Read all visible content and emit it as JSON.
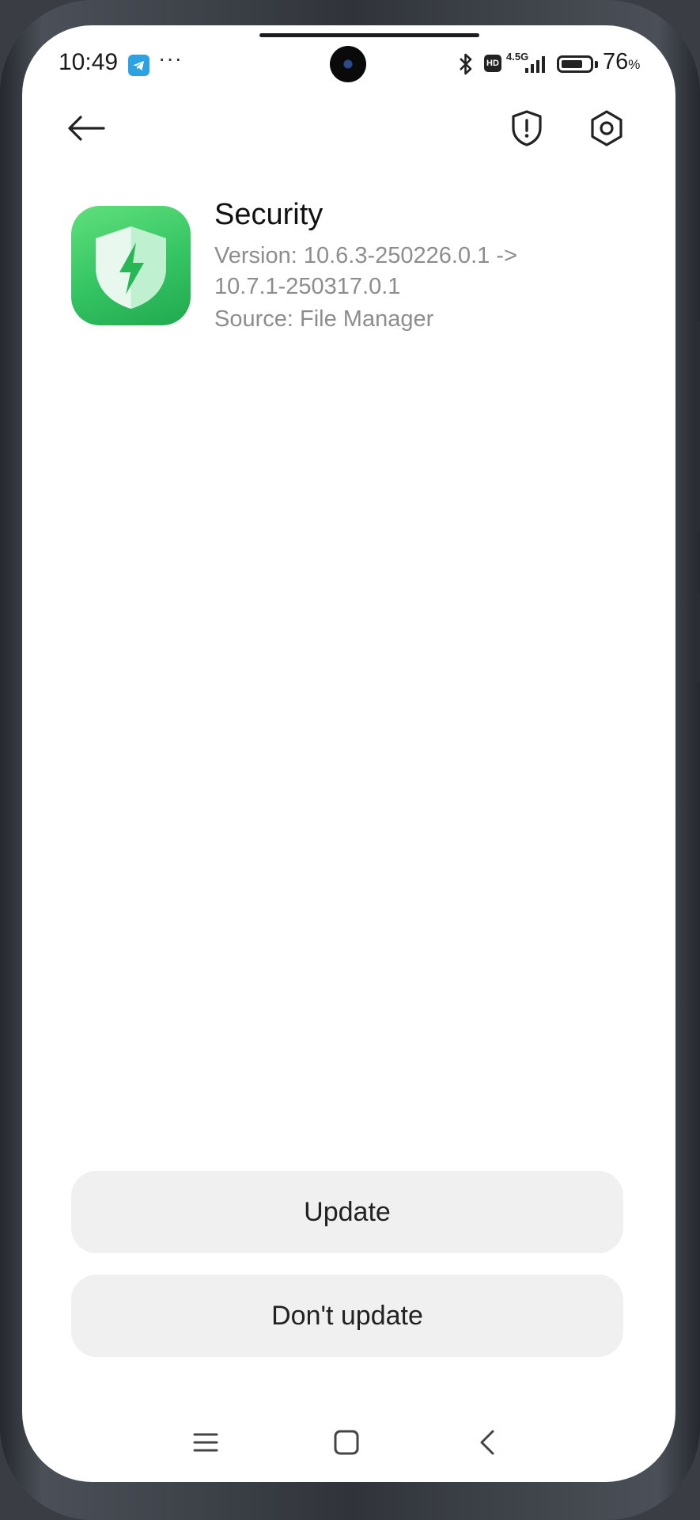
{
  "status_bar": {
    "time": "10:49",
    "more": "···",
    "hd": "HD",
    "network": "4.5G",
    "battery_percent": "76",
    "battery_unit": "%",
    "battery_level": 0.76
  },
  "top_bar": {
    "back_icon": "arrow-left-icon",
    "shield_icon": "shield-alert-icon",
    "settings_icon": "hexagon-gear-icon"
  },
  "app": {
    "name": "Security",
    "version_line1": "Version: 10.6.3-250226.0.1 ->",
    "version_line2": "10.7.1-250317.0.1",
    "source": "Source: File Manager",
    "icon": "shield-bolt-icon"
  },
  "actions": {
    "update_label": "Update",
    "dont_update_label": "Don't update"
  },
  "nav_bar": {
    "menu_icon": "menu-icon",
    "home_icon": "square-icon",
    "back_icon": "chevron-left-icon"
  },
  "colors": {
    "accent_green": "#34c463",
    "telegram_blue": "#2aa2e3",
    "button_bg": "#f0f0f0",
    "secondary_text": "#8d8d8d"
  }
}
